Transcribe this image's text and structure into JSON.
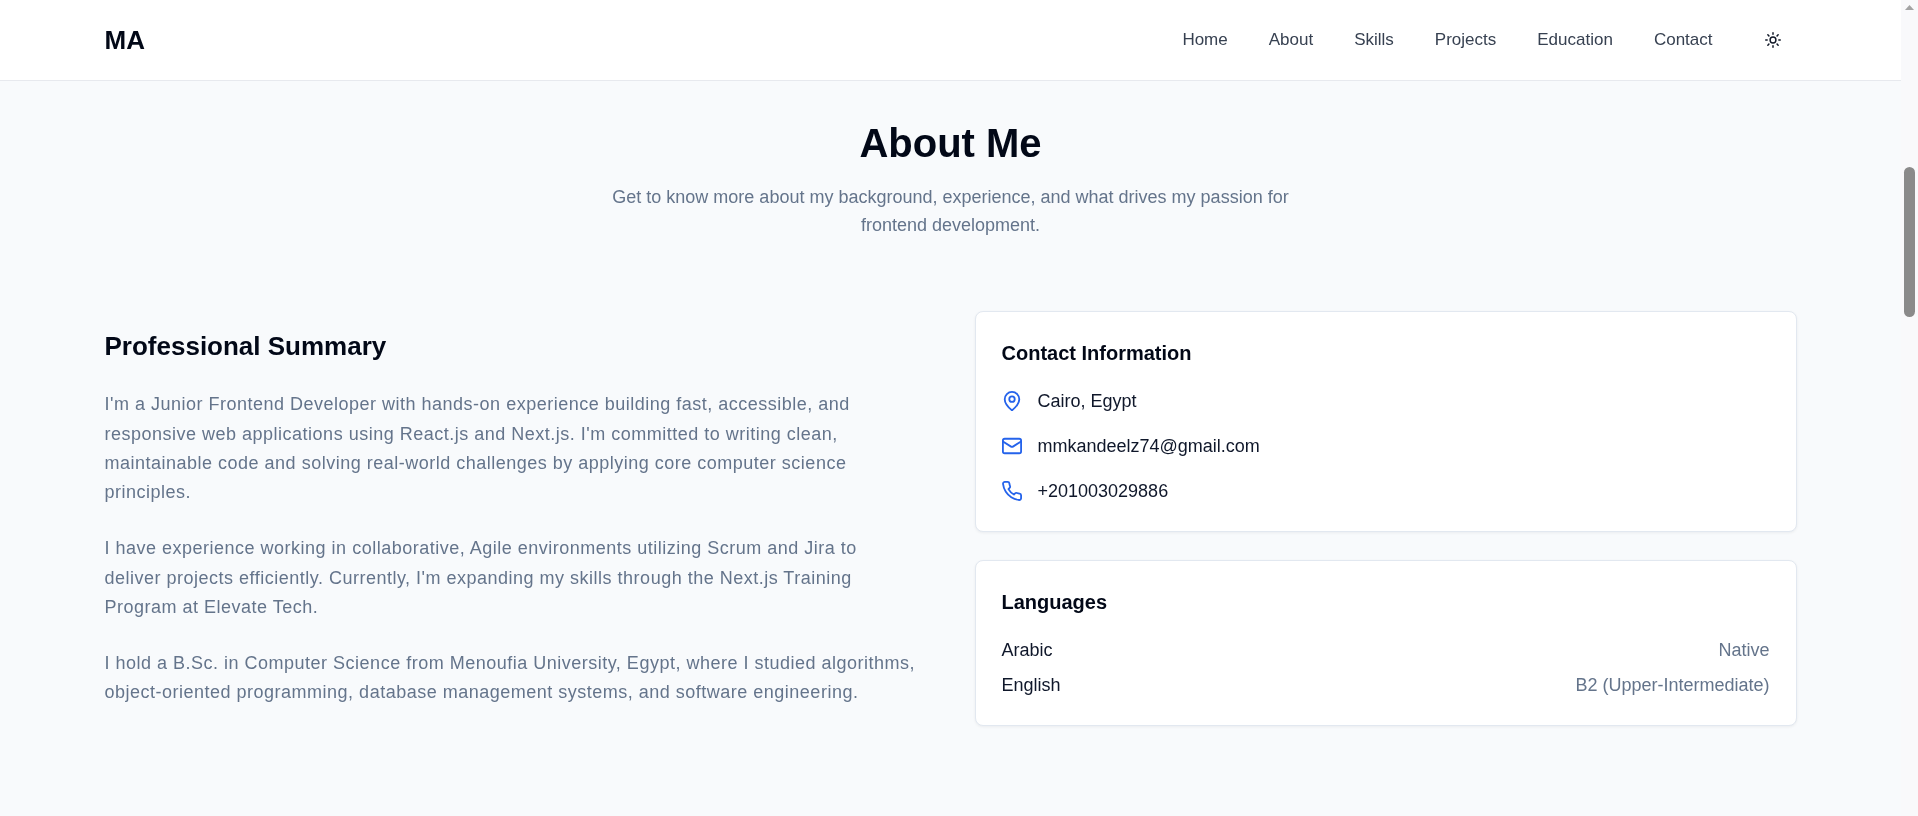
{
  "navbar": {
    "brand": "MA",
    "links": [
      {
        "label": "Home"
      },
      {
        "label": "About"
      },
      {
        "label": "Skills"
      },
      {
        "label": "Projects"
      },
      {
        "label": "Education"
      },
      {
        "label": "Contact"
      }
    ]
  },
  "section": {
    "title": "About Me",
    "subtitle": "Get to know more about my background, experience, and what drives my passion for frontend development."
  },
  "summary": {
    "title": "Professional Summary",
    "paragraphs": [
      "I'm a Junior Frontend Developer with hands-on experience building fast, accessible, and responsive web applications using React.js and Next.js. I'm committed to writing clean, maintainable code and solving real-world challenges by applying core computer science principles.",
      "I have experience working in collaborative, Agile environments utilizing Scrum and Jira to deliver projects efficiently. Currently, I'm expanding my skills through the Next.js Training Program at Elevate Tech.",
      "I hold a B.Sc. in Computer Science from Menoufia University, Egypt, where I studied algorithms, object-oriented programming, database management systems, and software engineering."
    ]
  },
  "contact": {
    "title": "Contact Information",
    "items": [
      {
        "kind": "location",
        "text": "Cairo, Egypt"
      },
      {
        "kind": "email",
        "text": "mmkandeelz74@gmail.com"
      },
      {
        "kind": "phone",
        "text": "+201003029886"
      }
    ]
  },
  "languages": {
    "title": "Languages",
    "items": [
      {
        "language": "Arabic",
        "proficiency": "Native"
      },
      {
        "language": "English",
        "proficiency": "B2 (Upper-Intermediate)"
      }
    ]
  }
}
